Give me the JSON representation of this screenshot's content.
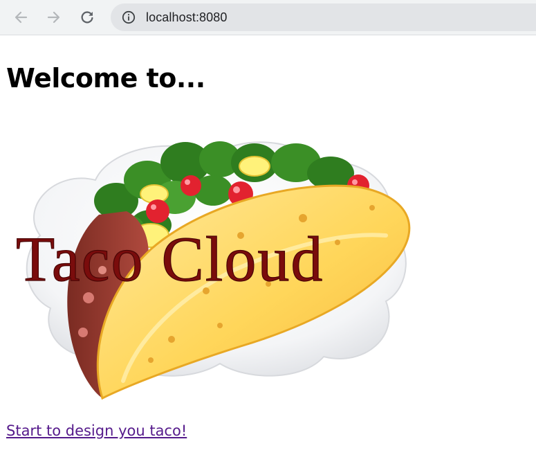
{
  "browser": {
    "url": "localhost:8080",
    "back_icon": "arrow-left-icon",
    "forward_icon": "arrow-right-icon",
    "reload_icon": "reload-icon",
    "info_icon": "info-icon"
  },
  "page": {
    "heading": "Welcome to...",
    "logo_text": "Taco Cloud",
    "link_text": "Start to design you taco!",
    "link_color": "#551a8b"
  }
}
